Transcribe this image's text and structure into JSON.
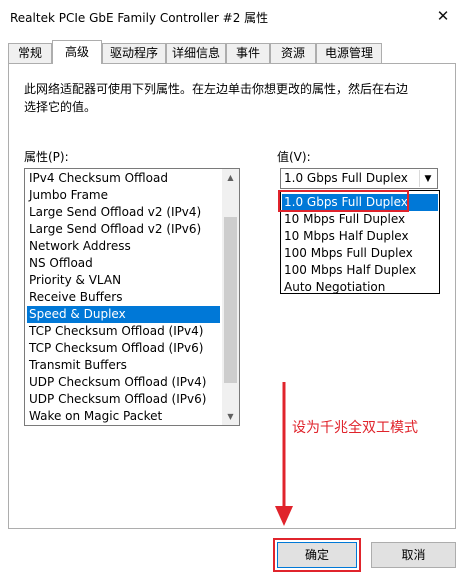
{
  "window": {
    "title": "Realtek PCIe GbE Family Controller #2 属性",
    "close_glyph": "✕"
  },
  "tabs": [
    {
      "label": "常规",
      "active": false
    },
    {
      "label": "高级",
      "active": true
    },
    {
      "label": "驱动程序",
      "active": false
    },
    {
      "label": "详细信息",
      "active": false
    },
    {
      "label": "事件",
      "active": false
    },
    {
      "label": "资源",
      "active": false
    },
    {
      "label": "电源管理",
      "active": false
    }
  ],
  "description": "此网络适配器可使用下列属性。在左边单击你想更改的属性，然后在右边选择它的值。",
  "property_label": "属性(P):",
  "value_label": "值(V):",
  "properties": [
    "IPv4 Checksum Offload",
    "Jumbo Frame",
    "Large Send Offload v2 (IPv4)",
    "Large Send Offload v2 (IPv6)",
    "Network Address",
    "NS Offload",
    "Priority & VLAN",
    "Receive Buffers",
    "Speed & Duplex",
    "TCP Checksum Offload (IPv4)",
    "TCP Checksum Offload (IPv6)",
    "Transmit Buffers",
    "UDP Checksum Offload (IPv4)",
    "UDP Checksum Offload (IPv6)",
    "Wake on Magic Packet"
  ],
  "selected_property": "Speed & Duplex",
  "value_combo": {
    "current": "1.0 Gbps Full Duplex"
  },
  "value_options": [
    "1.0 Gbps Full Duplex",
    "10 Mbps Full Duplex",
    "10 Mbps Half Duplex",
    "100 Mbps Full Duplex",
    "100 Mbps Half Duplex",
    "Auto Negotiation"
  ],
  "selected_value": "1.0 Gbps Full Duplex",
  "annotation": {
    "text": "设为千兆全双工模式",
    "color": "#e0242c"
  },
  "buttons": {
    "ok": "确定",
    "cancel": "取消"
  },
  "colors": {
    "selection": "#0078d7",
    "annotation": "#e0242c"
  },
  "icons": {
    "scroll_up": "▲",
    "scroll_down": "▼",
    "combo_arrow": "▼"
  }
}
